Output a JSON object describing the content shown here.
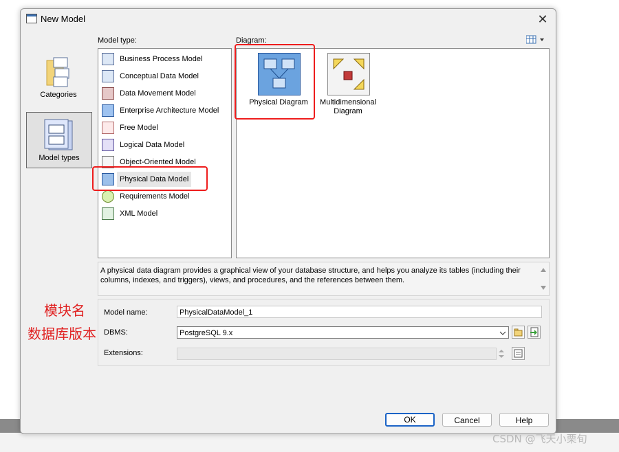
{
  "window": {
    "title": "New Model",
    "close_glyph": "✕"
  },
  "categories_pane": {
    "items": [
      {
        "label": "Categories",
        "selected": false,
        "icon": "folder-icon"
      },
      {
        "label": "Model types",
        "selected": true,
        "icon": "model-types-icon"
      }
    ]
  },
  "model_type": {
    "label": "Model type:",
    "items": [
      {
        "label": "Business Process Model",
        "icon": "business-process-icon"
      },
      {
        "label": "Conceptual Data Model",
        "icon": "conceptual-data-icon"
      },
      {
        "label": "Data Movement Model",
        "icon": "data-movement-icon"
      },
      {
        "label": "Enterprise Architecture Model",
        "icon": "enterprise-architecture-icon"
      },
      {
        "label": "Free Model",
        "icon": "free-model-icon"
      },
      {
        "label": "Logical Data Model",
        "icon": "logical-data-icon"
      },
      {
        "label": "Object-Oriented Model",
        "icon": "object-oriented-icon"
      },
      {
        "label": "Physical Data Model",
        "icon": "physical-data-icon",
        "selected": true
      },
      {
        "label": "Requirements Model",
        "icon": "requirements-icon"
      },
      {
        "label": "XML Model",
        "icon": "xml-model-icon"
      }
    ]
  },
  "diagram": {
    "label": "Diagram:",
    "items": [
      {
        "label": "Physical Diagram",
        "icon": "physical-diagram-icon",
        "selected": true
      },
      {
        "label_line1": "Multidimensional",
        "label_line2": "Diagram",
        "icon": "multidimensional-diagram-icon"
      }
    ]
  },
  "description": "A physical data diagram provides a graphical view of your database structure, and helps you analyze its tables (including their columns, indexes, and triggers), views, and procedures, and the references between them.",
  "fields": {
    "model_name": {
      "label": "Model name:",
      "value": "PhysicalDataModel_1"
    },
    "dbms": {
      "label": "DBMS:",
      "value": "PostgreSQL 9.x"
    },
    "extensions": {
      "label": "Extensions:",
      "value": ""
    }
  },
  "buttons": {
    "ok": "OK",
    "cancel": "Cancel",
    "help": "Help"
  },
  "annotations": {
    "module_name": "模块名",
    "db_version": "数据库版本"
  },
  "watermark": "CSDN @飞天小栗旬",
  "colors": {
    "annotation_red": "#ee1c1c",
    "default_button_border": "#1a63c6"
  }
}
